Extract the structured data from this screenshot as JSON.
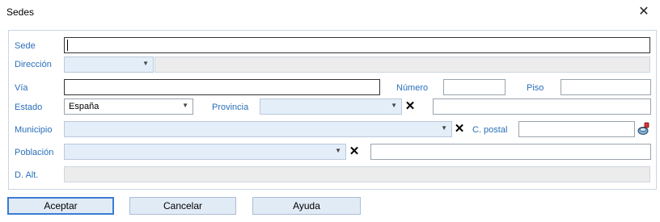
{
  "window": {
    "title": "Sedes"
  },
  "labels": {
    "sede": "Sede",
    "direccion": "Dirección",
    "via": "Vía",
    "numero": "Número",
    "piso": "Piso",
    "estado": "Estado",
    "provincia": "Provincia",
    "municipio": "Municipio",
    "c_postal": "C. postal",
    "poblacion": "Población",
    "d_alt": "D. Alt."
  },
  "fields": {
    "sede": "",
    "direccion": "",
    "via": "",
    "numero": "",
    "piso": "",
    "estado": "España",
    "provincia": "",
    "provincia_extra": "",
    "municipio": "",
    "c_postal": "",
    "poblacion": "",
    "poblacion_extra": "",
    "d_alt": ""
  },
  "buttons": {
    "aceptar": "Aceptar",
    "cancelar": "Cancelar",
    "ayuda": "Ayuda"
  },
  "colors": {
    "label": "#2a6fba",
    "combo_bg": "#e3eef9",
    "button_bg": "#e1ebf6",
    "default_border": "#3b7bd4"
  },
  "icons": {
    "close": "close-icon",
    "clear": "clear-x-icon",
    "postal_lookup": "postal-code-lookup-icon",
    "dropdown": "chevron-down-icon"
  }
}
